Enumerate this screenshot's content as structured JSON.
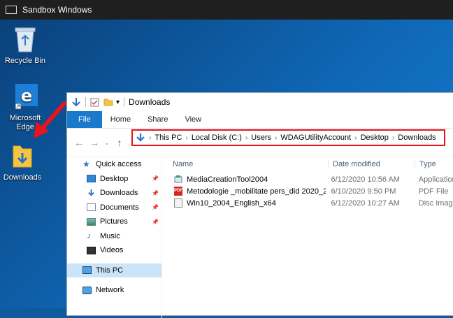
{
  "titlebar": {
    "title": "Sandbox Windows"
  },
  "desktop": {
    "icons": [
      {
        "name": "recycle-bin",
        "label": "Recycle Bin"
      },
      {
        "name": "microsoft-edge",
        "label": "Microsoft Edge"
      },
      {
        "name": "downloads",
        "label": "Downloads"
      }
    ]
  },
  "explorer": {
    "title": "Downloads",
    "ribbon_tabs": [
      "File",
      "Home",
      "Share",
      "View"
    ],
    "address": [
      "This PC",
      "Local Disk (C:)",
      "Users",
      "WDAGUtilityAccount",
      "Desktop",
      "Downloads"
    ],
    "nav": {
      "quick_access": "Quick access",
      "items": [
        "Desktop",
        "Downloads",
        "Documents",
        "Pictures",
        "Music",
        "Videos"
      ],
      "this_pc": "This PC",
      "network": "Network"
    },
    "columns": [
      "Name",
      "Date modified",
      "Type"
    ],
    "files": [
      {
        "name": "MediaCreationTool2004",
        "date": "6/12/2020 10:56 AM",
        "type": "Application"
      },
      {
        "name": "Metodologie _mobilitate pers_did 2020_2...",
        "date": "6/10/2020 9:50 PM",
        "type": "PDF File"
      },
      {
        "name": "Win10_2004_English_x64",
        "date": "6/12/2020 10:27 AM",
        "type": "Disc Image"
      }
    ]
  },
  "colors": {
    "accent": "#1979ca",
    "highlight": "#e8131b",
    "selection": "#cce4f7"
  }
}
